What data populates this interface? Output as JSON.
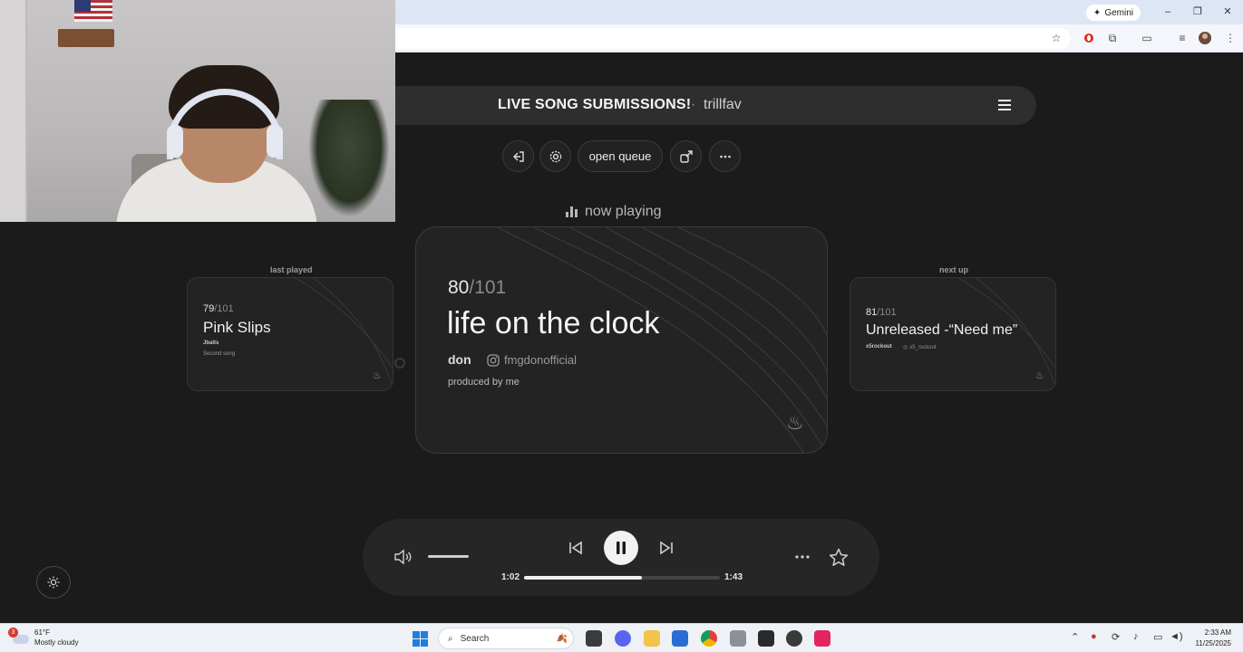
{
  "browser": {
    "gemini_label": "Gemini",
    "win_min": "–",
    "win_restore": "❐",
    "win_close": "✕"
  },
  "app": {
    "title": "LIVE SONG SUBMISSIONS!",
    "separator": "·",
    "username": "trillfav",
    "actions": {
      "open_queue_label": "open queue"
    },
    "now_playing_label": "now playing",
    "last_played": {
      "heading": "last played",
      "index": "79",
      "total": "/101",
      "title": "Pink Slips",
      "artist": "Jbalts",
      "note": "Second song"
    },
    "current": {
      "index": "80",
      "total": "/101",
      "title": "life on the clock",
      "artist": "don",
      "instagram": "fmgdonofficial",
      "note": "produced by me"
    },
    "next_up": {
      "heading": "next up",
      "index": "81",
      "total": "/101",
      "title": "Unreleased -“Need me”",
      "artist": "x5rockout",
      "instagram": "x5_rockout"
    },
    "player": {
      "elapsed": "1:02",
      "duration": "1:43",
      "progress_fraction": 0.6,
      "volume_fraction": 1.0
    }
  },
  "taskbar": {
    "weather_temp": "61°F",
    "weather_desc": "Mostly cloudy",
    "weather_badge": "3",
    "search_placeholder": "Search",
    "time": "2:33 AM",
    "date": "11/25/2025"
  },
  "colors": {
    "background": "#1b1b1b",
    "card": "#232323",
    "accent": "#f2f2f2",
    "browser_chrome": "#dde6f4"
  }
}
